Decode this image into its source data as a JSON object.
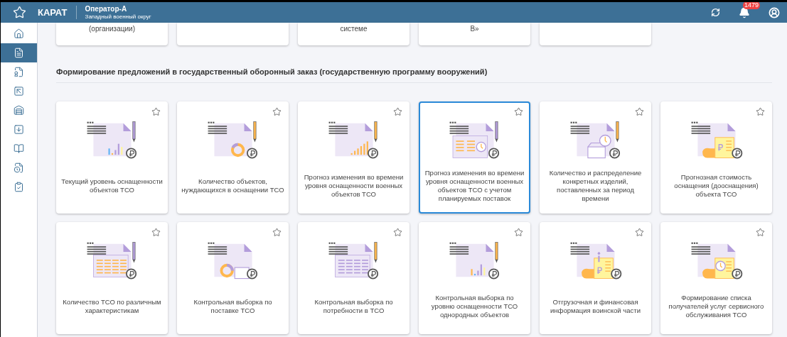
{
  "header": {
    "logo": "КАРАТ",
    "user": "Оператор-А",
    "district": "Западный военный округ",
    "notifications": "1479"
  },
  "sidebar": {
    "items": [
      {
        "selected": false
      },
      {
        "selected": true
      },
      {
        "selected": false
      },
      {
        "selected": false
      },
      {
        "selected": false
      },
      {
        "selected": false
      },
      {
        "selected": false
      },
      {
        "selected": false
      },
      {
        "selected": false
      }
    ]
  },
  "top_cards": [
    {
      "kind": "text",
      "title": "(организации)"
    },
    {
      "kind": "blank"
    },
    {
      "kind": "text",
      "title": "системе"
    },
    {
      "kind": "text",
      "title": "В»"
    },
    {
      "kind": "blank"
    }
  ],
  "section": {
    "title": "Формирование предложений в государственный оборонный заказ (государственную программу вооружений)"
  },
  "cards": [
    {
      "title": "Текущий уровень оснащенности объектов ТСО",
      "kind": "bars",
      "favorite": false,
      "selected": false
    },
    {
      "title": "Количество объектов, нуждающихся в оснащении ТСО",
      "kind": "donut",
      "favorite": false,
      "selected": false
    },
    {
      "title": "Прогноз изменения во времени уровня оснащенности военных объектов ТСО",
      "kind": "growth",
      "favorite": false,
      "selected": false
    },
    {
      "title": "Прогноз изменения во времени уровня оснащенности военных объектов ТСО с учетом планируемых поставок",
      "kind": "table_clock",
      "favorite": false,
      "selected": true
    },
    {
      "title": "Количество и распределение конкретных изделий, поставленных за период времени",
      "kind": "box_clock",
      "favorite": false,
      "selected": false
    },
    {
      "title": "Прогнозная стоимость оснащения (дооснащения) объекта ТСО",
      "kind": "receipt",
      "favorite": false,
      "selected": false
    },
    {
      "title": "Количество ТСО по различным характеристикам",
      "kind": "table_orange",
      "favorite": false,
      "selected": false
    },
    {
      "title": "Контрольная выборка по поставке ТСО",
      "kind": "donut_box",
      "favorite": false,
      "selected": false
    },
    {
      "title": "Контрольная выборка по потребности в ТСО",
      "kind": "table_purple",
      "favorite": false,
      "selected": false
    },
    {
      "title": "Контрольная выборка по уровню оснащенности ТСО однородных объектов",
      "kind": "bars_orange",
      "favorite": false,
      "selected": false
    },
    {
      "title": "Отгрузочная и финансовая информация воинской части",
      "kind": "receipt_info",
      "favorite": false,
      "selected": false
    },
    {
      "title": "Формирование списка получателей услуг сервисного обслуживания ТСО",
      "kind": "receipt_clock",
      "favorite": false,
      "selected": false
    }
  ]
}
